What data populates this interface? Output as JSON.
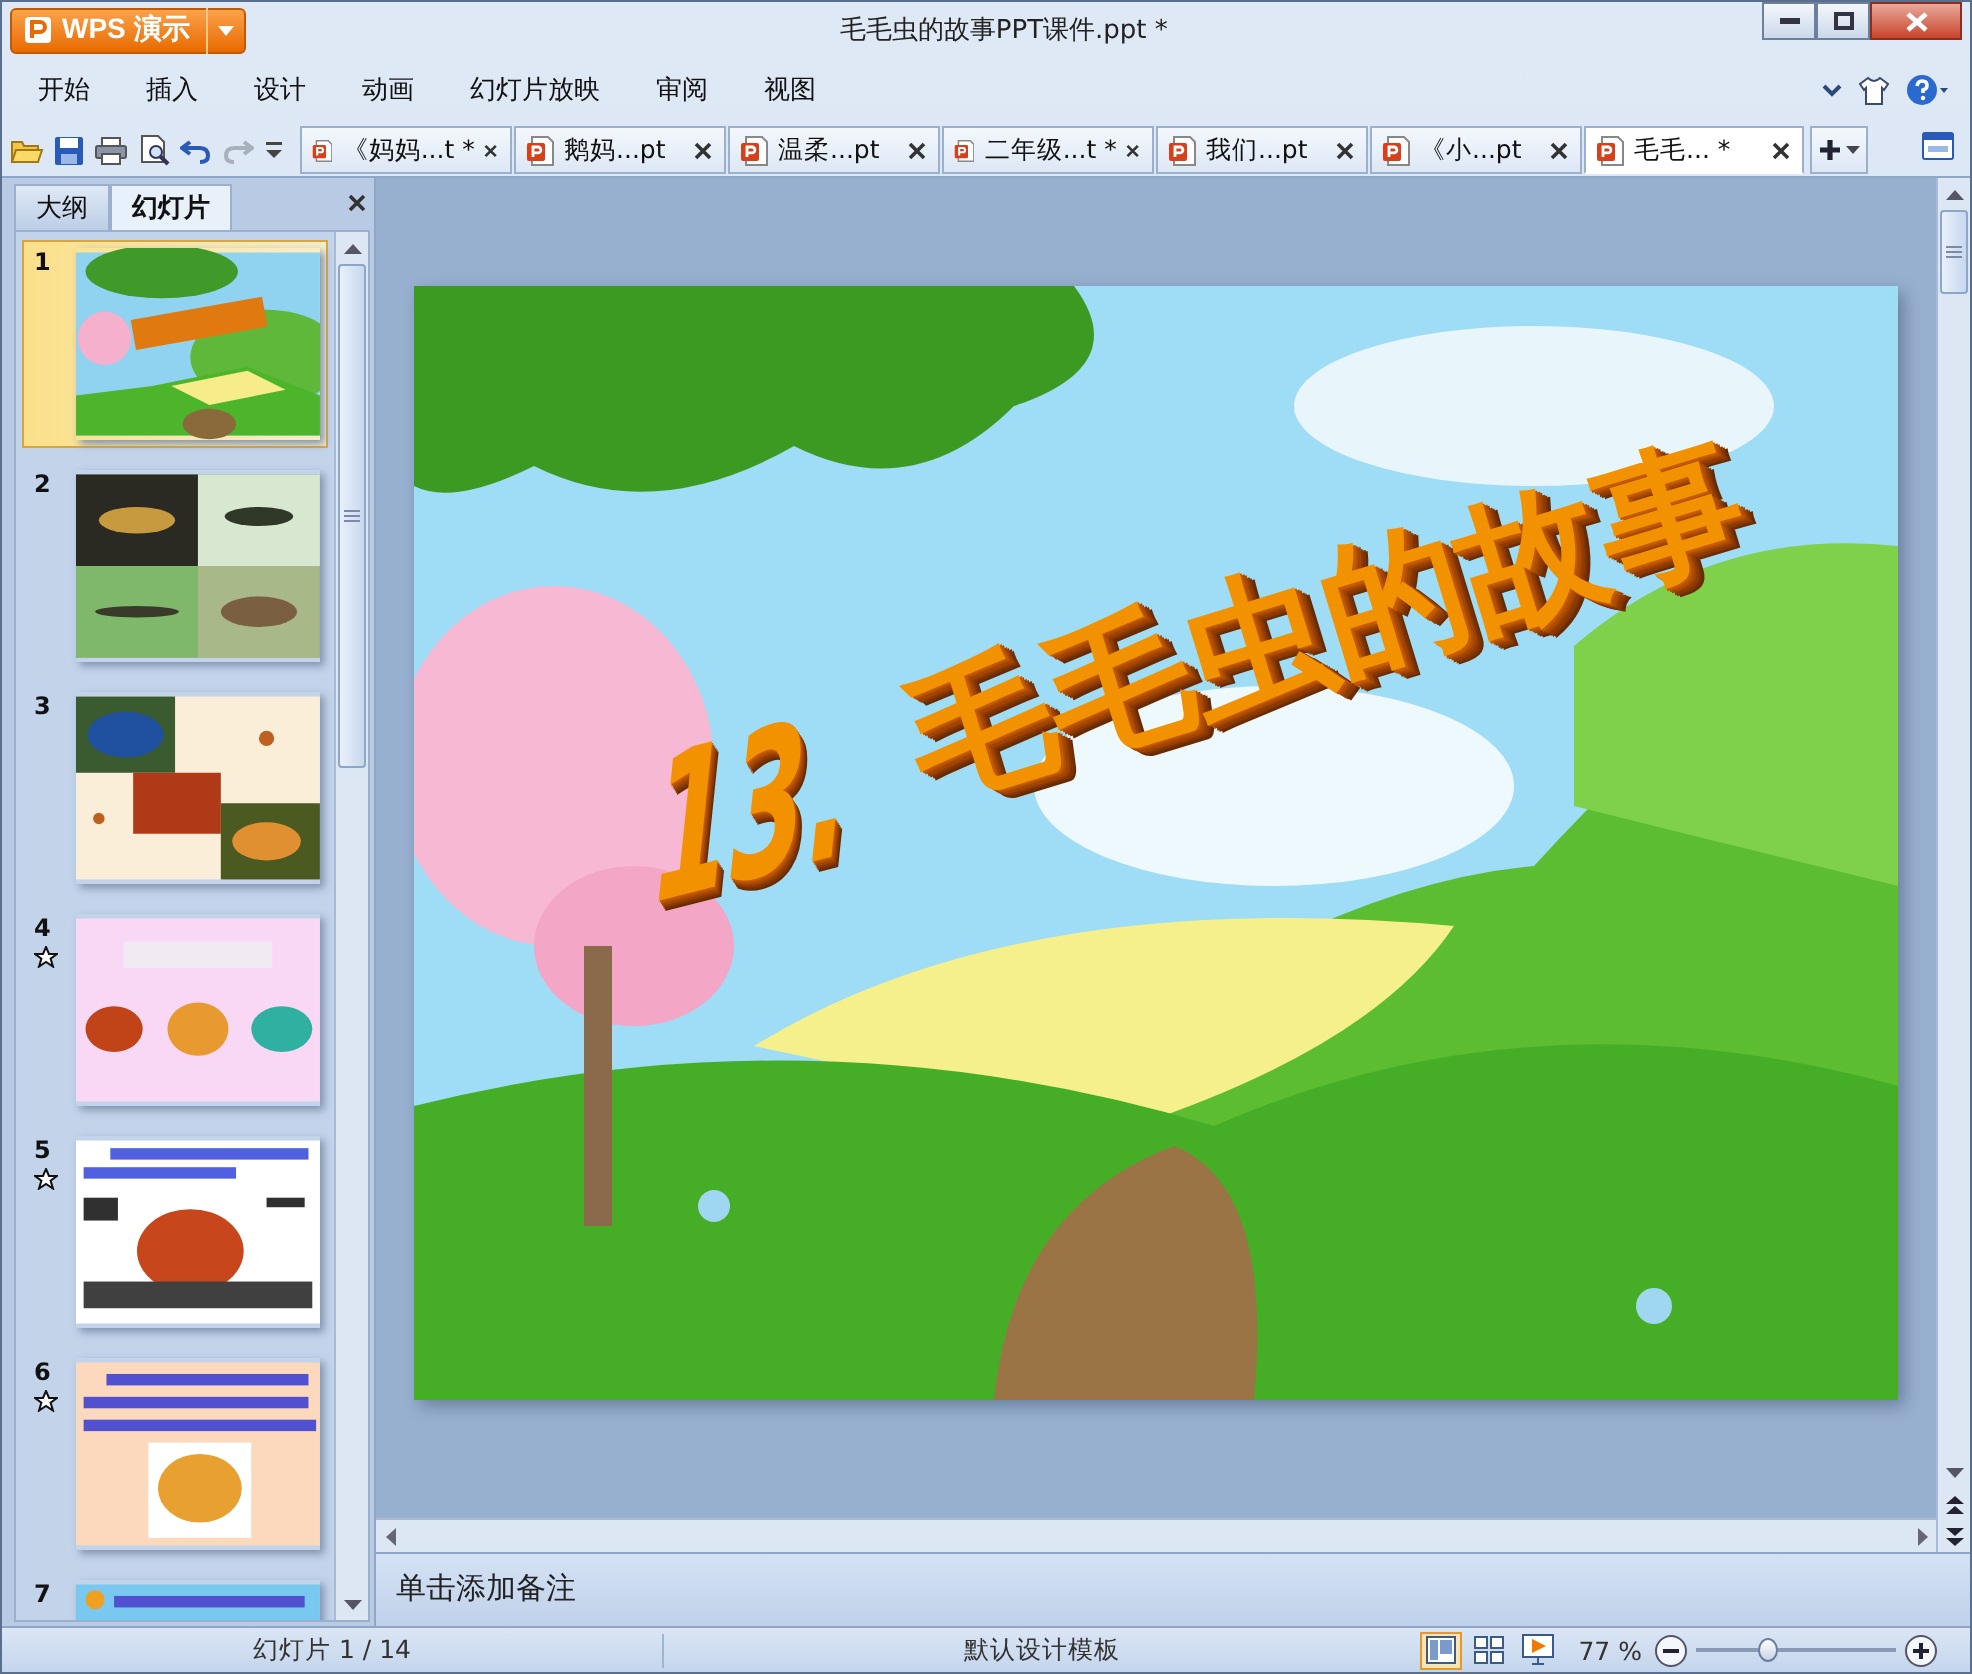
{
  "app": {
    "button": "WPS 演示"
  },
  "window": {
    "title": "毛毛虫的故事PPT课件.ppt *"
  },
  "menu": [
    "开始",
    "插入",
    "设计",
    "动画",
    "幻灯片放映",
    "审阅",
    "视图"
  ],
  "doc_tabs": [
    {
      "label": "《妈妈...t *",
      "selected": false
    },
    {
      "label": "鹅妈...pt",
      "selected": false
    },
    {
      "label": "温柔...pt",
      "selected": false
    },
    {
      "label": "二年级...t *",
      "selected": false
    },
    {
      "label": "我们...pt",
      "selected": false
    },
    {
      "label": "《小...pt",
      "selected": false
    },
    {
      "label": "毛毛... *",
      "selected": true
    }
  ],
  "panel": {
    "tabs": [
      {
        "label": "大纲",
        "selected": false
      },
      {
        "label": "幻灯片",
        "selected": true
      }
    ]
  },
  "slides": [
    {
      "number": "1",
      "selected": true,
      "animated": false
    },
    {
      "number": "2",
      "selected": false,
      "animated": false
    },
    {
      "number": "3",
      "selected": false,
      "animated": false
    },
    {
      "number": "4",
      "selected": false,
      "animated": true
    },
    {
      "number": "5",
      "selected": false,
      "animated": true
    },
    {
      "number": "6",
      "selected": false,
      "animated": true
    },
    {
      "number": "7",
      "selected": false,
      "animated": false
    }
  ],
  "slide": {
    "title_number": "13.",
    "title": "毛毛虫的故事"
  },
  "notes": {
    "placeholder": "单击添加备注"
  },
  "status_bar": {
    "slide_info": "幻灯片 1 / 14",
    "template": "默认设计模板",
    "views": [
      {
        "kind": "normal",
        "selected": true
      },
      {
        "kind": "sorter",
        "selected": false
      },
      {
        "kind": "show",
        "selected": false
      }
    ],
    "zoom": "77 %",
    "zoom_slider": {
      "level": 0.36
    }
  }
}
